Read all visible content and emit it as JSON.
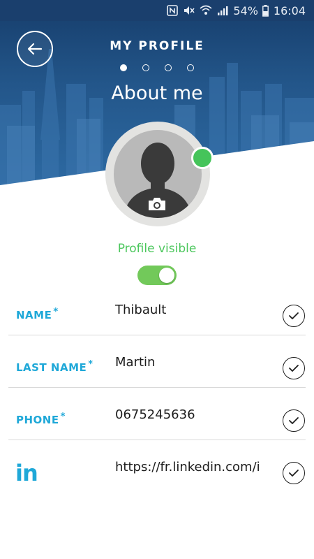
{
  "status_bar": {
    "battery": "54%",
    "time": "16:04",
    "icons": [
      "nfc-icon",
      "mute-icon",
      "wifi-icon",
      "signal-icon",
      "battery-icon"
    ]
  },
  "header": {
    "title": "MY PROFILE",
    "subtitle": "About me",
    "back_icon": "back-arrow-icon",
    "pager": {
      "total": 4,
      "active": 1
    }
  },
  "profile": {
    "visibility_label": "Profile visible",
    "visible": true,
    "online_color": "#45c45a",
    "camera_icon": "camera-icon"
  },
  "form": {
    "fields": [
      {
        "label": "NAME",
        "required_mark": "*",
        "value": "Thibault"
      },
      {
        "label": "LAST NAME",
        "required_mark": "*",
        "value": "Martin"
      },
      {
        "label": "PHONE",
        "required_mark": "*",
        "value": "0675245636"
      }
    ],
    "linkedin": {
      "logo": "in",
      "value": "https://fr.linkedin.com/i"
    }
  },
  "colors": {
    "accent_blue": "#1fa8d8",
    "success_green": "#4cc75d",
    "header_blue": "#1a3f6d"
  }
}
